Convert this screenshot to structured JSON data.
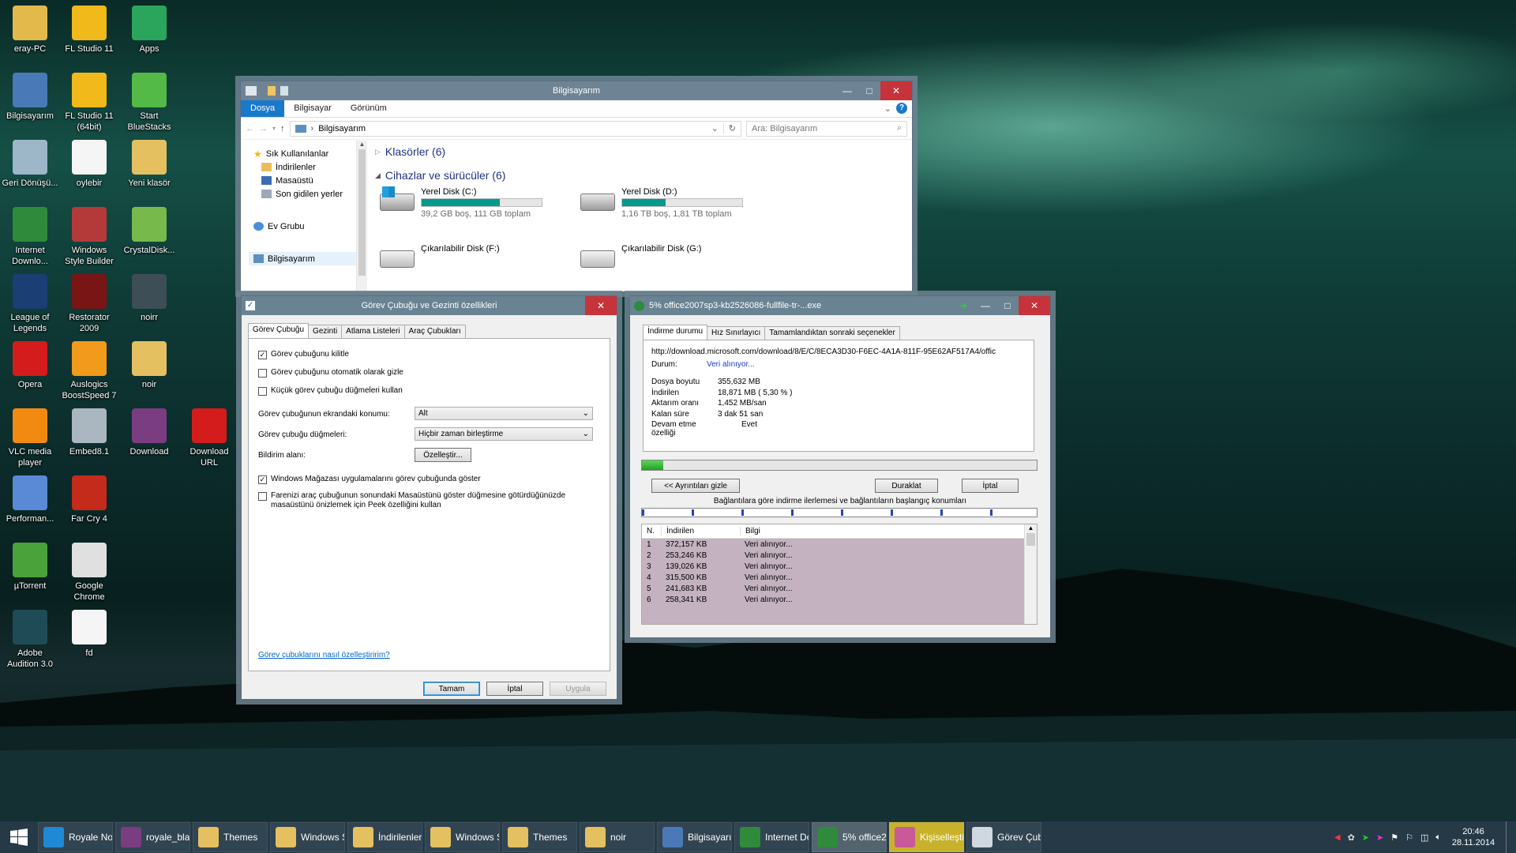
{
  "desktop": {
    "icons": [
      {
        "label": "eray-PC",
        "icon": "user-folder-icon"
      },
      {
        "label": "FL Studio 11",
        "icon": "fl-studio-icon"
      },
      {
        "label": "Apps",
        "icon": "apps-icon"
      },
      {
        "label": "Bilgisayarım",
        "icon": "computer-icon"
      },
      {
        "label": "FL Studio 11 (64bit)",
        "icon": "fl-studio-icon"
      },
      {
        "label": "Start BlueStacks",
        "icon": "bluestacks-icon"
      },
      {
        "label": "Geri Dönüşü...",
        "icon": "recycle-bin-icon"
      },
      {
        "label": "oylebir",
        "icon": "mp3-file-icon"
      },
      {
        "label": "Yeni klasör",
        "icon": "folder-icon"
      },
      {
        "label": "Internet Downlo...",
        "icon": "idm-icon"
      },
      {
        "label": "Windows Style Builder",
        "icon": "style-builder-icon"
      },
      {
        "label": "CrystalDisk...",
        "icon": "crystaldisk-icon"
      },
      {
        "label": "League of Legends",
        "icon": "lol-icon"
      },
      {
        "label": "Restorator 2009",
        "icon": "restorator-icon"
      },
      {
        "label": "noirr",
        "icon": "noirr-icon"
      },
      {
        "label": "Opera",
        "icon": "opera-icon"
      },
      {
        "label": "Auslogics BoostSpeed 7",
        "icon": "auslogics-icon"
      },
      {
        "label": "noir",
        "icon": "folder-icon"
      },
      {
        "label": "VLC media player",
        "icon": "vlc-icon"
      },
      {
        "label": "Embed8.1",
        "icon": "embed-icon"
      },
      {
        "label": "Download",
        "icon": "winrar-icon"
      },
      {
        "label": "Download URL",
        "icon": "opera-icon"
      },
      {
        "label": "Performan...",
        "icon": "performance-icon"
      },
      {
        "label": "Far Cry 4",
        "icon": "farcry-icon"
      },
      {
        "label": "µTorrent",
        "icon": "utorrent-icon"
      },
      {
        "label": "Google Chrome",
        "icon": "chrome-icon"
      },
      {
        "label": "Adobe Audition 3.0",
        "icon": "audition-icon"
      },
      {
        "label": "fd",
        "icon": "mp3-file-icon"
      }
    ]
  },
  "explorer": {
    "title": "Bilgisayarım",
    "tabs": [
      "Dosya",
      "Bilgisayar",
      "Görünüm"
    ],
    "address": "Bilgisayarım",
    "search_placeholder": "Ara: Bilgisayarım",
    "nav": {
      "favorites": "Sık Kullanılanlar",
      "items": [
        "İndirilenler",
        "Masaüstü",
        "Son gidilen yerler"
      ],
      "homegroup": "Ev Grubu",
      "computer": "Bilgisayarım"
    },
    "folders_header": "Klasörler (6)",
    "devices_header": "Cihazlar ve sürücüler (6)",
    "drives": [
      {
        "name": "Yerel Disk (C:)",
        "info": "39,2 GB boş, 111 GB toplam",
        "used_fraction": 0.65
      },
      {
        "name": "Yerel Disk (D:)",
        "info": "1,16 TB boş, 1,81 TB toplam",
        "used_fraction": 0.36
      },
      {
        "name": "Çıkarılabilir Disk (F:)",
        "info": ""
      },
      {
        "name": "Çıkarılabilir Disk (G:)",
        "info": ""
      }
    ]
  },
  "taskbar_dialog": {
    "title": "Görev Çubuğu ve Gezinti özellikleri",
    "tabs": [
      "Görev Çubuğu",
      "Gezinti",
      "Atlama Listeleri",
      "Araç Çubukları"
    ],
    "checks": [
      {
        "label": "Görev çubuğunu kilitle",
        "checked": true
      },
      {
        "label": "Görev çubuğunu otomatik olarak gizle",
        "checked": false
      },
      {
        "label": "Küçük görev çubuğu düğmeleri kullan",
        "checked": false
      }
    ],
    "position_label": "Görev çubuğunun ekrandaki konumu:",
    "position_value": "Alt",
    "buttons_label": "Görev çubuğu düğmeleri:",
    "buttons_value": "Hiçbir zaman birleştirme",
    "notify_label": "Bildirim alanı:",
    "customize_btn": "Özelleştir...",
    "store_check": "Windows Mağazası uygulamalarını görev çubuğunda göster",
    "peek_check": "Farenizi araç çubuğunun sonundaki Masaüstünü göster düğmesine götürdüğünüzde masaüstünü önizlemek için Peek özelliğini kullan",
    "help_link": "Görev çubuklarını nasıl özelleştiririm?",
    "ok": "Tamam",
    "cancel": "İptal",
    "apply": "Uygula"
  },
  "idm": {
    "title": "5% office2007sp3-kb2526086-fullfile-tr-...exe",
    "tabs": [
      "İndirme durumu",
      "Hız Sınırlayıcı",
      "Tamamlandıktan sonraki seçenekler"
    ],
    "url": "http://download.microsoft.com/download/8/E/C/8ECA3D30-F6EC-4A1A-811F-95E62AF517A4/offic",
    "status_label": "Durum:",
    "status_value": "Veri alınıyor...",
    "rows": [
      {
        "k": "Dosya boyutu",
        "v": "355,632  MB"
      },
      {
        "k": "İndirilen",
        "v": "18,871  MB  ( 5,30 % )"
      },
      {
        "k": "Aktarım oranı",
        "v": "1,452  MB/san"
      },
      {
        "k": "Kalan süre",
        "v": "3 dak 51 san"
      },
      {
        "k": "Devam etme özelliği",
        "v": "Evet"
      }
    ],
    "progress": 0.053,
    "details_btn": "<< Ayrıntıları gizle",
    "pause_btn": "Duraklat",
    "cancel_btn": "İptal",
    "segments_caption": "Bağlantılara göre indirme ilerlemesi ve bağlantıların başlangıç konumları",
    "table_headers": [
      "N.",
      "İndirilen",
      "Bilgi"
    ],
    "table": [
      {
        "n": "1",
        "d": "372,157  KB",
        "i": "Veri alınıyor..."
      },
      {
        "n": "2",
        "d": "253,246  KB",
        "i": "Veri alınıyor..."
      },
      {
        "n": "3",
        "d": "139,026  KB",
        "i": "Veri alınıyor..."
      },
      {
        "n": "4",
        "d": "315,500  KB",
        "i": "Veri alınıyor..."
      },
      {
        "n": "5",
        "d": "241,683  KB",
        "i": "Veri alınıyor..."
      },
      {
        "n": "6",
        "d": "258,341  KB",
        "i": "Veri alınıyor..."
      }
    ]
  },
  "taskbar": {
    "items": [
      {
        "label": "Royale Noi...",
        "icon": "ie-icon"
      },
      {
        "label": "royale_blac...",
        "icon": "winrar-icon"
      },
      {
        "label": "Themes",
        "icon": "folder-icon"
      },
      {
        "label": "Windows S...",
        "icon": "folder-icon"
      },
      {
        "label": "İndirilenler",
        "icon": "folder-icon"
      },
      {
        "label": "Windows S...",
        "icon": "folder-icon"
      },
      {
        "label": "Themes",
        "icon": "folder-icon"
      },
      {
        "label": "noir",
        "icon": "folder-icon"
      },
      {
        "label": "Bilgisayarım",
        "icon": "computer-icon"
      },
      {
        "label": "Internet Do...",
        "icon": "idm-icon"
      },
      {
        "label": "5% office2...",
        "icon": "idm-icon"
      },
      {
        "label": "Kişiselleştir...",
        "icon": "personalize-icon"
      },
      {
        "label": "Görev Çub...",
        "icon": "taskbar-props-icon"
      }
    ],
    "time": "20:46",
    "date": "28.11.2014"
  }
}
